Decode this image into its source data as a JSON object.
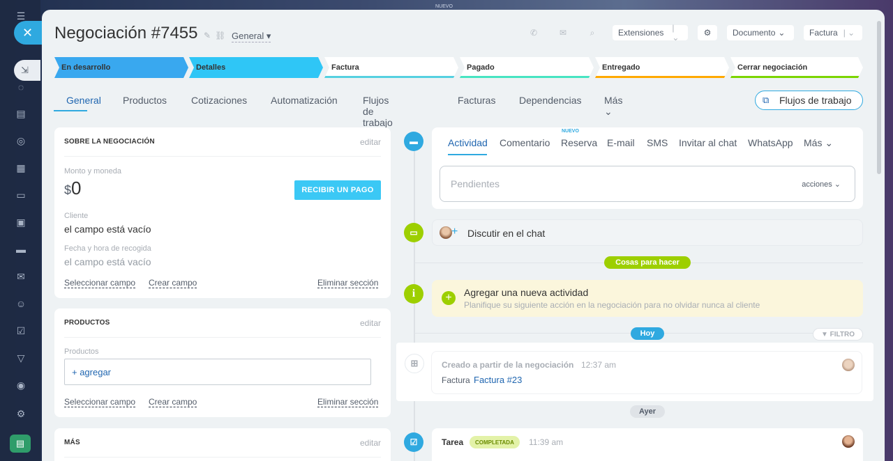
{
  "top": {
    "nuevo": "NUEVO"
  },
  "sidebar": {
    "icons": [
      "menu-icon",
      "chat-icon",
      "document-icon",
      "settings-icon",
      "calendar-icon",
      "file-icon",
      "board-icon",
      "card-icon",
      "mail-icon",
      "users-icon",
      "check-icon",
      "filter-icon",
      "robot-icon",
      "gear-icon",
      "market-icon"
    ]
  },
  "header": {
    "title": "Negociación #7455",
    "pipeline": "General",
    "extensions": "Extensiones",
    "document": "Documento",
    "invoice": "Factura"
  },
  "stages": [
    {
      "label": "En desarrollo",
      "color": "#39a8ef"
    },
    {
      "label": "Detalles",
      "color": "#2fc6f6"
    },
    {
      "label": "Factura",
      "color": "#ffffff",
      "line": "#55d0e0"
    },
    {
      "label": "Pagado",
      "color": "#ffffff",
      "line": "#47e4c2"
    },
    {
      "label": "Entregado",
      "color": "#ffffff",
      "line": "#ffa900"
    },
    {
      "label": "Cerrar negociación",
      "color": "#ffffff",
      "line": "#7bd500"
    }
  ],
  "tabs": [
    "General",
    "Productos",
    "Cotizaciones",
    "Automatización",
    "Flujos de trabajo",
    "Facturas",
    "Dependencias",
    "Más"
  ],
  "flujos_button": "Flujos de trabajo",
  "about": {
    "title": "SOBRE LA NEGOCIACIÓN",
    "edit": "editar",
    "amount_label": "Monto y moneda",
    "currency": "$",
    "amount": "0",
    "pay_button": "RECIBIR UN PAGO",
    "client_label": "Cliente",
    "client_value": "el campo está vacío",
    "date_label": "Fecha y hora de recogida",
    "date_value": "el campo está vacío",
    "select_field": "Seleccionar campo",
    "create_field": "Crear campo",
    "delete_section": "Eliminar sección"
  },
  "products": {
    "title": "PRODUCTOS",
    "edit": "editar",
    "label": "Productos",
    "add": "+ agregar",
    "select_field": "Seleccionar campo",
    "create_field": "Crear campo",
    "delete_section": "Eliminar sección"
  },
  "more": {
    "title": "MÁS",
    "edit": "editar"
  },
  "activity": {
    "tabs": [
      "Actividad",
      "Comentario",
      "Reserva",
      "E-mail",
      "SMS",
      "Invitar al chat",
      "WhatsApp",
      "Más"
    ],
    "nuevo": "NUEVO",
    "pending": "Pendientes",
    "actions": "acciones"
  },
  "chat": {
    "label": "Discutir en el chat"
  },
  "todo_badge": "Cosas para hacer",
  "new_activity": {
    "title": "Agregar una nueva actividad",
    "desc": "Planifique su siguiente acción en la negociación para no olvidar nunca al cliente"
  },
  "today_badge": "Hoy",
  "filter": "FILTRO",
  "created": {
    "title": "Creado a partir de la negociación",
    "time": "12:37 am",
    "label": "Factura",
    "link": "Factura #23"
  },
  "yesterday_badge": "Ayer",
  "task": {
    "title": "Tarea",
    "status": "COMPLETADA",
    "time": "11:39 am"
  },
  "colors": {
    "accent": "#2fa9e0",
    "link": "#2066b0",
    "green": "#9dcf00"
  }
}
